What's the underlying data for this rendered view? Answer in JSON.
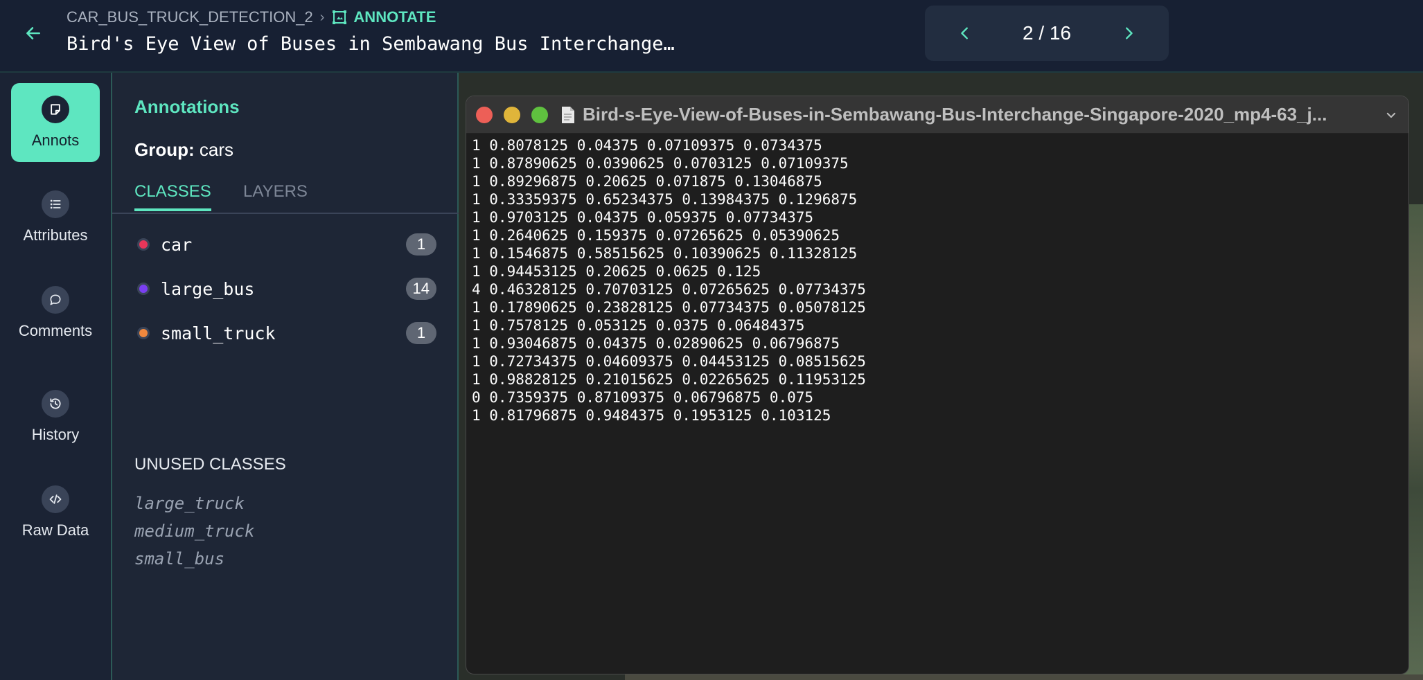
{
  "header": {
    "breadcrumb_project": "CAR_BUS_TRUCK_DETECTION_2",
    "breadcrumb_section": "ANNOTATE",
    "title": "Bird's Eye View of Buses in Sembawang Bus Interchange…",
    "pager_text": "2 / 16",
    "accent": "#5ee6c0"
  },
  "rail": {
    "items": [
      {
        "label": "Annots",
        "icon": "annotation-icon"
      },
      {
        "label": "Attributes",
        "icon": "list-icon"
      },
      {
        "label": "Comments",
        "icon": "comment-icon"
      },
      {
        "label": "History",
        "icon": "history-icon"
      },
      {
        "label": "Raw Data",
        "icon": "code-icon"
      }
    ]
  },
  "panel": {
    "title": "Annotations",
    "group_label": "Group:",
    "group_value": "cars",
    "tabs": [
      "CLASSES",
      "LAYERS"
    ],
    "classes": [
      {
        "name": "car",
        "count": "1",
        "color": "#e8365a"
      },
      {
        "name": "large_bus",
        "count": "14",
        "color": "#7a3ff2"
      },
      {
        "name": "small_truck",
        "count": "1",
        "color": "#f0883e"
      }
    ],
    "unused_title": "UNUSED CLASSES",
    "unused": [
      "large_truck",
      "medium_truck",
      "small_bus"
    ]
  },
  "viewer": {
    "filename": "Bird-s-Eye-View-of-Buses-in-Sembawang-Bus-Interchange-Singapore-2020_mp4-63_j...",
    "lines": [
      "1 0.8078125 0.04375 0.07109375 0.0734375",
      "1 0.87890625 0.0390625 0.0703125 0.07109375",
      "1 0.89296875 0.20625 0.071875 0.13046875",
      "1 0.33359375 0.65234375 0.13984375 0.1296875",
      "1 0.9703125 0.04375 0.059375 0.07734375",
      "1 0.2640625 0.159375 0.07265625 0.05390625",
      "1 0.1546875 0.58515625 0.10390625 0.11328125",
      "1 0.94453125 0.20625 0.0625 0.125",
      "4 0.46328125 0.70703125 0.07265625 0.07734375",
      "1 0.17890625 0.23828125 0.07734375 0.05078125",
      "1 0.7578125 0.053125 0.0375 0.06484375",
      "1 0.93046875 0.04375 0.02890625 0.06796875",
      "1 0.72734375 0.04609375 0.04453125 0.08515625",
      "1 0.98828125 0.21015625 0.02265625 0.11953125",
      "0 0.7359375 0.87109375 0.06796875 0.075",
      "1 0.81796875 0.9484375 0.1953125 0.103125"
    ]
  }
}
